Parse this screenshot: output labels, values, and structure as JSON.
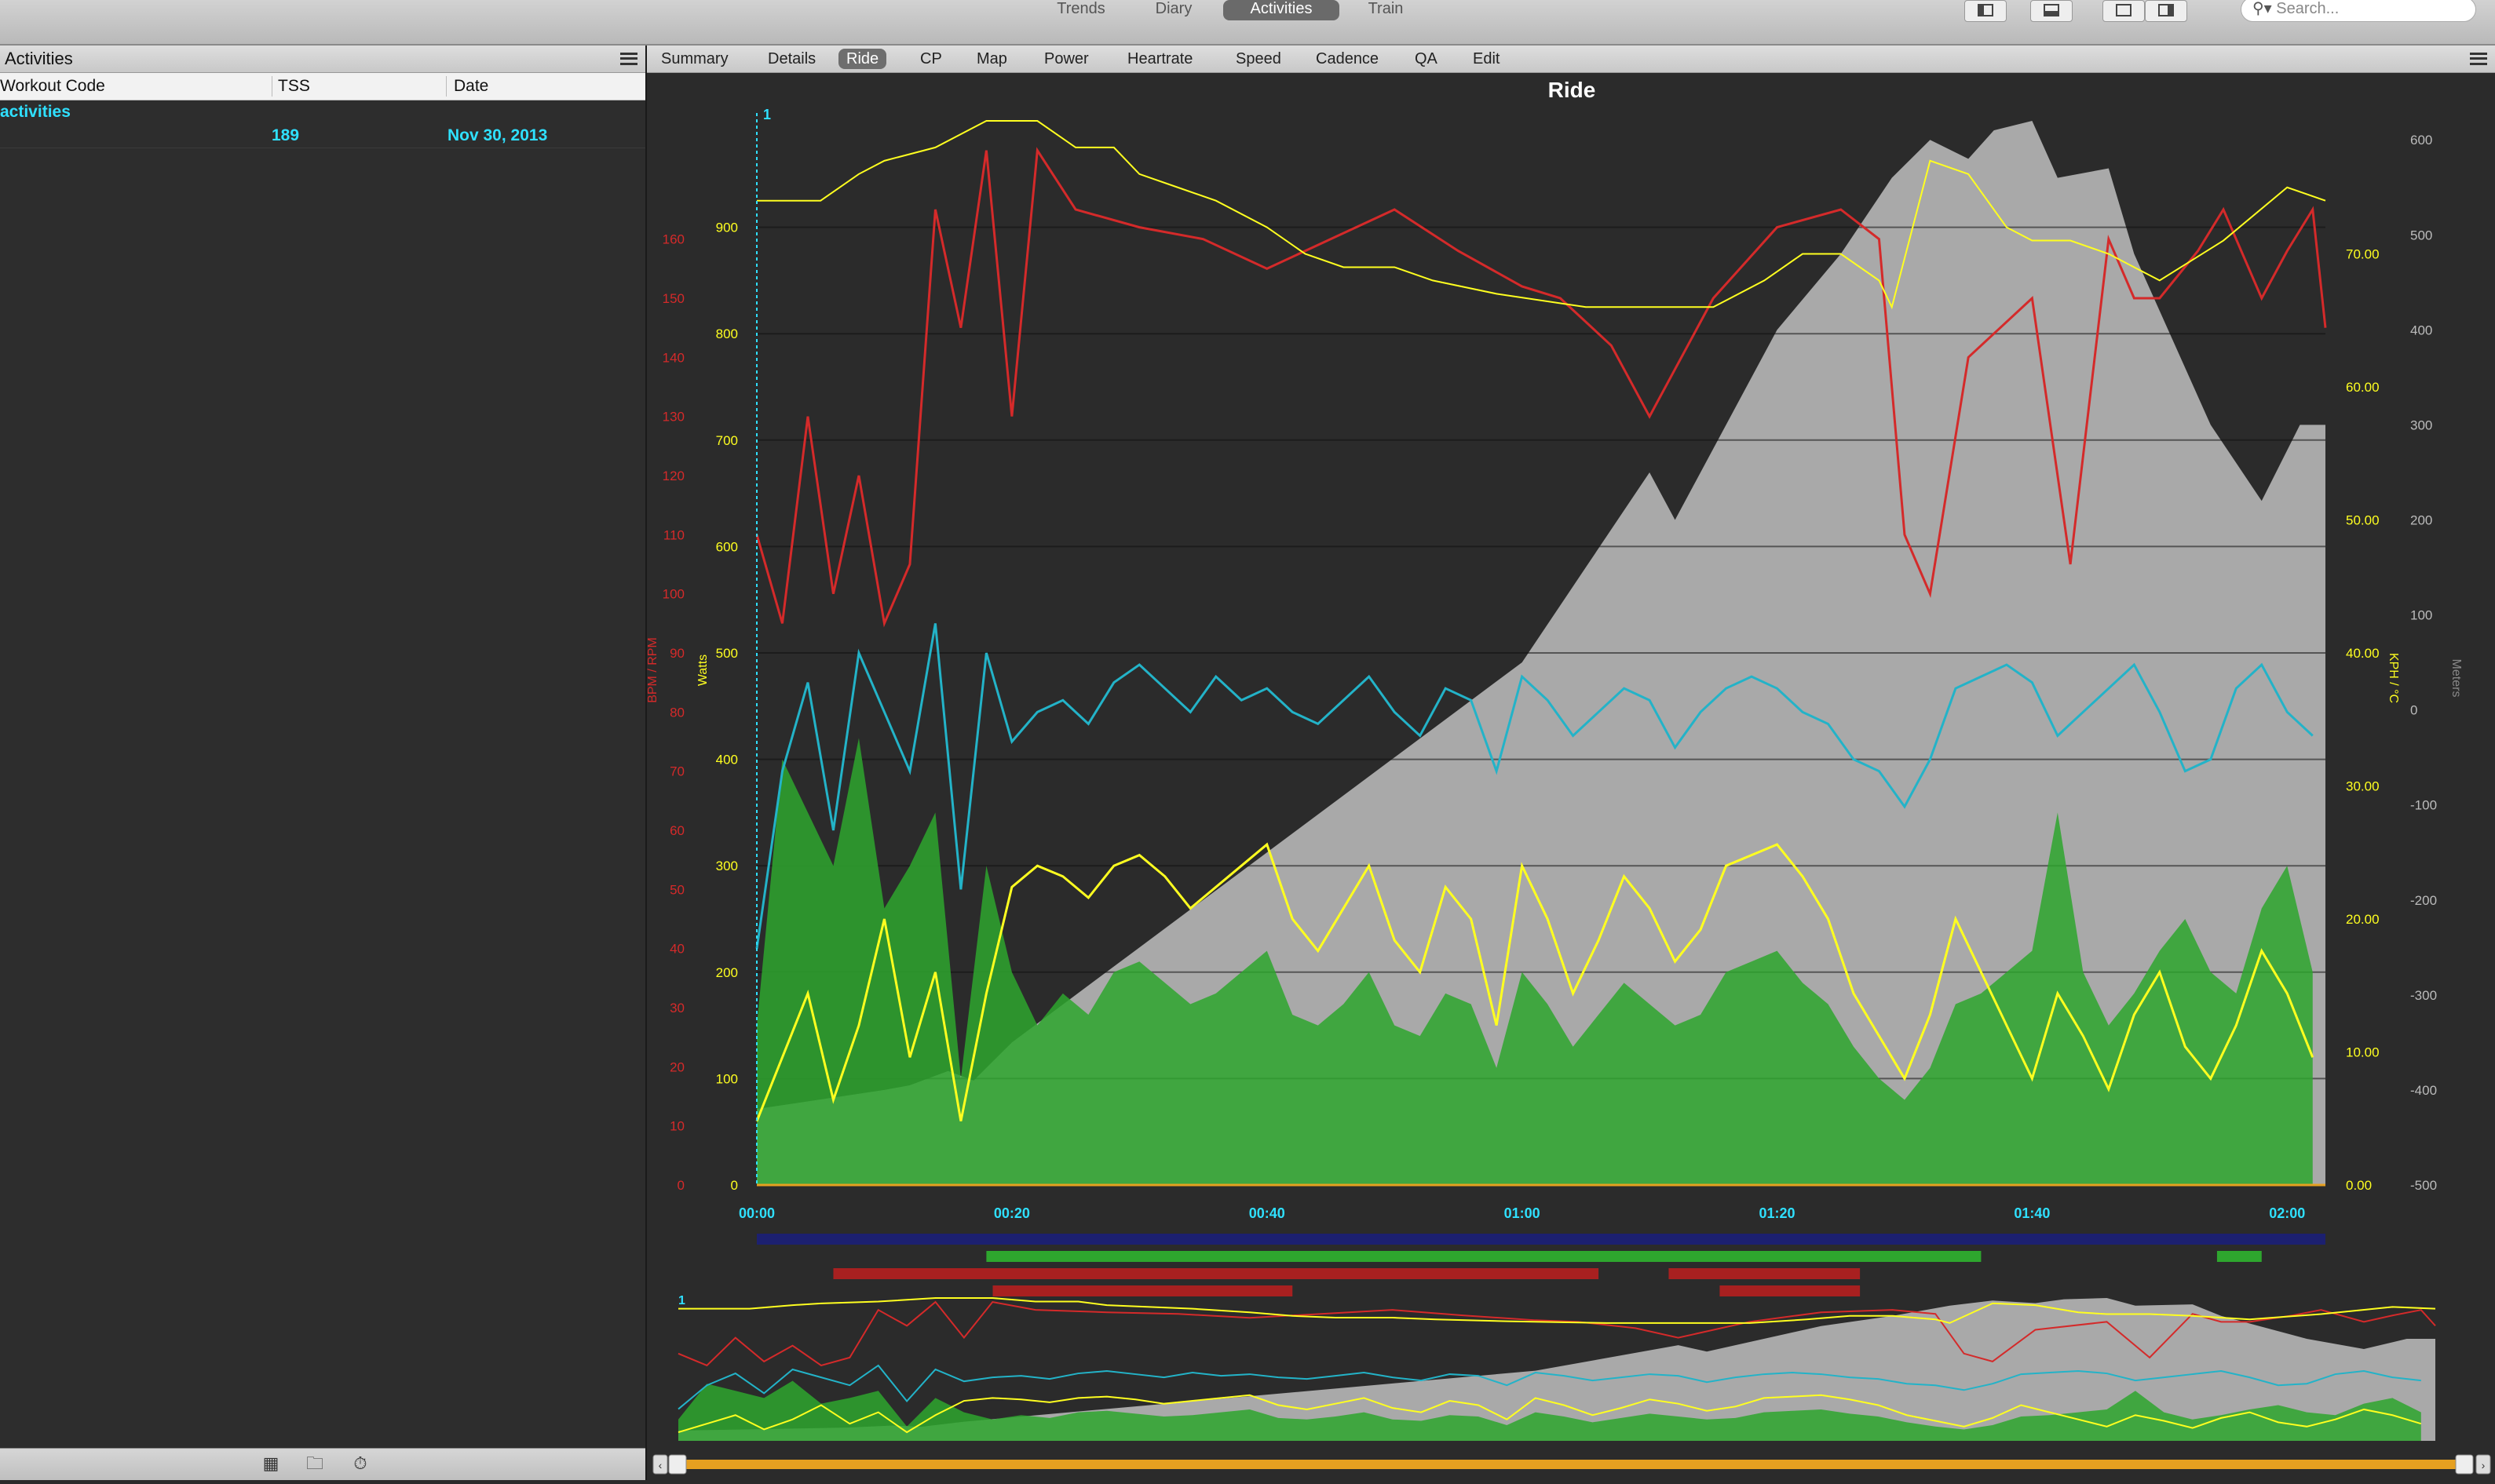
{
  "toolbar": {
    "tabs": [
      {
        "label": "Trends",
        "active": false
      },
      {
        "label": "Diary",
        "active": false
      },
      {
        "label": "Activities",
        "active": true
      },
      {
        "label": "Train",
        "active": false
      }
    ],
    "search_placeholder": "Search..."
  },
  "left": {
    "title": "Activities",
    "columns": [
      "Workout Code",
      "TSS",
      "Date"
    ],
    "group_label": "activities",
    "rows": [
      {
        "workout_code": "",
        "tss": "189",
        "date": "Nov 30, 2013"
      }
    ],
    "footer_icons": [
      "calendar-icon",
      "folder-icon",
      "stopwatch-icon"
    ]
  },
  "right": {
    "tabs": [
      "Summary",
      "Details",
      "Ride",
      "CP",
      "Map",
      "Power",
      "Heartrate",
      "Speed",
      "Cadence",
      "QA",
      "Edit"
    ],
    "active_tab": "Ride"
  },
  "colors": {
    "heartrate": "#d42a2a",
    "power": "#ffff20",
    "speed": "#ffff20",
    "cadence": "#23b3c8",
    "torque": "#2ea62e",
    "altitude": "#a9a9a9",
    "accent": "#2fe0ff",
    "scrollbar": "#e6a020"
  },
  "chart_data": {
    "type": "line",
    "title": "Ride",
    "interval_marker": "1",
    "x": {
      "ticks": [
        "00:00",
        "00:20",
        "00:40",
        "01:00",
        "01:20",
        "01:40",
        "02:00"
      ],
      "range_minutes": [
        0,
        123
      ]
    },
    "axes": [
      {
        "name": "BPM / RPM",
        "side": "left",
        "range": [
          0,
          180
        ],
        "ticks": [
          "0",
          "10",
          "20",
          "30",
          "40",
          "50",
          "60",
          "70",
          "80",
          "90",
          "100",
          "110",
          "120",
          "130",
          "140",
          "150",
          "160"
        ]
      },
      {
        "name": "Watts",
        "side": "left",
        "range": [
          0,
          1000
        ],
        "ticks": [
          "0",
          "100",
          "200",
          "300",
          "400",
          "500",
          "600",
          "700",
          "800",
          "900"
        ]
      },
      {
        "name": "KPH / °C",
        "side": "right",
        "range": [
          0,
          80
        ],
        "ticks": [
          "0.00",
          "10.00",
          "20.00",
          "30.00",
          "40.00",
          "50.00",
          "60.00",
          "70.00"
        ]
      },
      {
        "name": "Meters",
        "side": "right",
        "range": [
          -500,
          620
        ],
        "ticks": [
          "-500",
          "-400",
          "-300",
          "-200",
          "-100",
          "0",
          "100",
          "200",
          "300",
          "400",
          "500",
          "600"
        ]
      }
    ],
    "series": [
      {
        "name": "Altitude",
        "axis": "Meters",
        "x": [
          0,
          5,
          10,
          12,
          15,
          17,
          20,
          30,
          40,
          50,
          60,
          65,
          70,
          72,
          80,
          85,
          89,
          92,
          95,
          97,
          100,
          102,
          106,
          108,
          110,
          114,
          118,
          121,
          123
        ],
        "y": [
          -420,
          -410,
          -400,
          -395,
          -380,
          -390,
          -350,
          -250,
          -150,
          -50,
          50,
          150,
          250,
          200,
          400,
          480,
          560,
          600,
          580,
          610,
          620,
          560,
          570,
          480,
          420,
          300,
          220,
          300,
          300
        ]
      },
      {
        "name": "Heartrate",
        "axis": "BPM / RPM",
        "x": [
          0,
          2,
          4,
          6,
          8,
          10,
          12,
          14,
          16,
          18,
          20,
          22,
          25,
          30,
          35,
          40,
          45,
          50,
          55,
          60,
          63,
          67,
          70,
          75,
          80,
          85,
          88,
          90,
          92,
          95,
          100,
          103,
          106,
          108,
          110,
          113,
          115,
          118,
          120,
          122,
          123
        ],
        "y": [
          110,
          95,
          130,
          100,
          120,
          95,
          105,
          165,
          145,
          175,
          130,
          175,
          165,
          162,
          160,
          155,
          160,
          165,
          158,
          152,
          150,
          142,
          130,
          150,
          162,
          165,
          160,
          110,
          100,
          140,
          150,
          105,
          160,
          150,
          150,
          158,
          165,
          150,
          158,
          165,
          145
        ]
      },
      {
        "name": "Speed",
        "axis": "KPH / °C",
        "x": [
          0,
          3,
          5,
          8,
          10,
          14,
          18,
          22,
          25,
          28,
          30,
          33,
          36,
          40,
          43,
          46,
          50,
          53,
          58,
          65,
          70,
          75,
          79,
          82,
          85,
          88,
          89,
          92,
          95,
          98,
          100,
          103,
          106,
          108,
          110,
          115,
          120,
          123
        ],
        "y": [
          74,
          74,
          74,
          76,
          77,
          78,
          80,
          80,
          78,
          78,
          76,
          75,
          74,
          72,
          70,
          69,
          69,
          68,
          67,
          66,
          66,
          66,
          68,
          70,
          70,
          68,
          66,
          77,
          76,
          72,
          71,
          71,
          70,
          69,
          68,
          71,
          75,
          74
        ]
      },
      {
        "name": "Power",
        "axis": "Watts",
        "note": "dense trace; representative envelope",
        "x": [
          0,
          2,
          4,
          6,
          8,
          10,
          12,
          14,
          16,
          18,
          20,
          22,
          24,
          26,
          28,
          30,
          32,
          34,
          36,
          38,
          40,
          42,
          44,
          46,
          48,
          50,
          52,
          54,
          56,
          58,
          60,
          62,
          64,
          66,
          68,
          70,
          72,
          74,
          76,
          78,
          80,
          82,
          84,
          86,
          88,
          90,
          92,
          94,
          96,
          98,
          100,
          102,
          104,
          106,
          108,
          110,
          112,
          114,
          116,
          118,
          120,
          122
        ],
        "y": [
          60,
          120,
          180,
          80,
          150,
          250,
          120,
          200,
          60,
          180,
          280,
          300,
          290,
          270,
          300,
          310,
          290,
          260,
          280,
          300,
          320,
          250,
          220,
          260,
          300,
          230,
          200,
          280,
          250,
          150,
          300,
          250,
          180,
          230,
          290,
          260,
          210,
          240,
          300,
          310,
          320,
          290,
          250,
          180,
          140,
          100,
          160,
          250,
          200,
          150,
          100,
          180,
          140,
          90,
          160,
          200,
          130,
          100,
          150,
          220,
          180,
          120
        ]
      },
      {
        "name": "Cadence",
        "axis": "BPM / RPM",
        "x": [
          0,
          2,
          4,
          6,
          8,
          10,
          12,
          14,
          16,
          18,
          20,
          22,
          24,
          26,
          28,
          30,
          32,
          34,
          36,
          38,
          40,
          42,
          44,
          46,
          48,
          50,
          52,
          54,
          56,
          58,
          60,
          62,
          64,
          66,
          68,
          70,
          72,
          74,
          76,
          78,
          80,
          82,
          84,
          86,
          88,
          90,
          92,
          94,
          96,
          98,
          100,
          102,
          104,
          106,
          108,
          110,
          112,
          114,
          116,
          118,
          120,
          122
        ],
        "y": [
          40,
          70,
          85,
          60,
          90,
          80,
          70,
          95,
          50,
          90,
          75,
          80,
          82,
          78,
          85,
          88,
          84,
          80,
          86,
          82,
          84,
          80,
          78,
          82,
          86,
          80,
          76,
          84,
          82,
          70,
          86,
          82,
          76,
          80,
          84,
          82,
          74,
          80,
          84,
          86,
          84,
          80,
          78,
          72,
          70,
          64,
          72,
          84,
          86,
          88,
          85,
          76,
          80,
          84,
          88,
          80,
          70,
          72,
          84,
          88,
          80,
          76
        ]
      },
      {
        "name": "Torque",
        "axis": "Watts",
        "x": [
          0,
          2,
          4,
          6,
          8,
          10,
          12,
          14,
          16,
          18,
          20,
          22,
          24,
          26,
          28,
          30,
          32,
          34,
          36,
          38,
          40,
          42,
          44,
          46,
          48,
          50,
          52,
          54,
          56,
          58,
          60,
          62,
          64,
          66,
          68,
          70,
          72,
          74,
          76,
          78,
          80,
          82,
          84,
          86,
          88,
          90,
          92,
          94,
          96,
          98,
          100,
          102,
          104,
          106,
          108,
          110,
          112,
          114,
          116,
          118,
          120,
          122
        ],
        "y": [
          150,
          400,
          350,
          300,
          420,
          260,
          300,
          350,
          100,
          300,
          200,
          150,
          180,
          160,
          200,
          210,
          190,
          170,
          180,
          200,
          220,
          160,
          150,
          170,
          200,
          150,
          140,
          180,
          170,
          110,
          200,
          170,
          130,
          160,
          190,
          170,
          150,
          160,
          200,
          210,
          220,
          190,
          170,
          130,
          100,
          80,
          110,
          170,
          180,
          200,
          220,
          350,
          200,
          150,
          180,
          220,
          250,
          200,
          180,
          260,
          300,
          200
        ]
      }
    ],
    "intervals": [
      {
        "row": 0,
        "color": "#1c2070",
        "start": 0,
        "end": 123
      },
      {
        "row": 1,
        "color": "#2ea62e",
        "start": 18,
        "end": 96
      },
      {
        "row": 1,
        "color": "#2ea62e",
        "start": 114.5,
        "end": 118
      },
      {
        "row": 2,
        "color": "#a82020",
        "start": 6,
        "end": 66
      },
      {
        "row": 2,
        "color": "#a82020",
        "start": 71.5,
        "end": 86.5
      },
      {
        "row": 3,
        "color": "#a82020",
        "start": 18.5,
        "end": 42
      },
      {
        "row": 3,
        "color": "#a82020",
        "start": 75.5,
        "end": 86.5
      },
      {
        "row": 4,
        "color": "#a82020",
        "start": 21,
        "end": 41
      }
    ]
  }
}
